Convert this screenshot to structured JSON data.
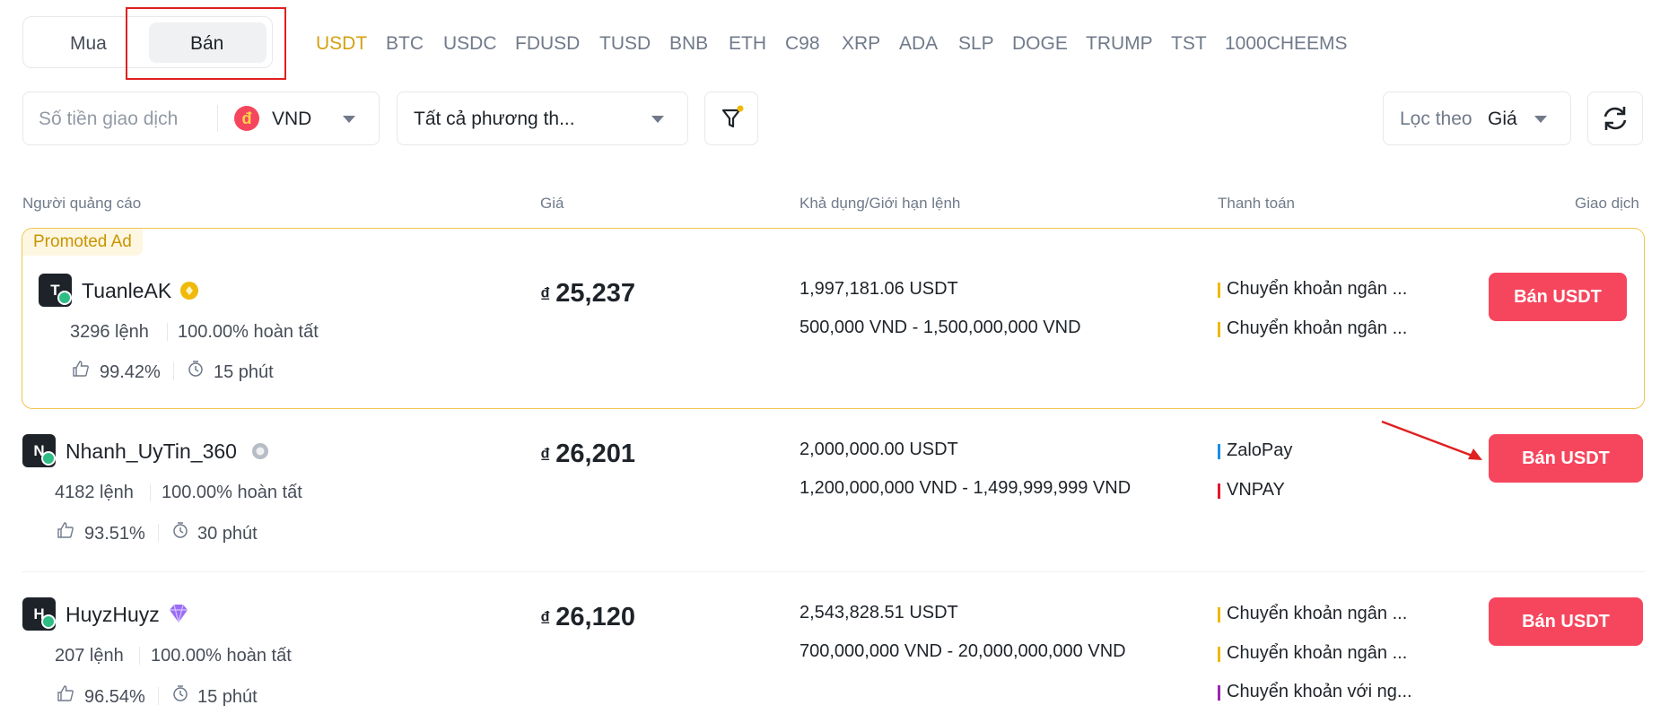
{
  "tabs": {
    "buy": "Mua",
    "sell": "Bán"
  },
  "coins": [
    "USDT",
    "BTC",
    "USDC",
    "FDUSD",
    "TUSD",
    "BNB",
    "ETH",
    "C98",
    "XRP",
    "ADA",
    "SLP",
    "DOGE",
    "TRUMP",
    "TST",
    "1000CHEEMS"
  ],
  "active_coin": "USDT",
  "filters": {
    "amount_placeholder": "Số tiền giao dịch",
    "currency": "VND",
    "currency_icon": "đ",
    "payment_method": "Tất cả phương th...",
    "sort_label": "Lọc theo",
    "sort_value": "Giá"
  },
  "table_headers": {
    "advertiser": "Người quảng cáo",
    "price": "Giá",
    "available": "Khả dụng/Giới hạn lệnh",
    "payment": "Thanh toán",
    "trade": "Giao dịch"
  },
  "promoted_label": "Promoted Ad",
  "rows": [
    {
      "initial": "T",
      "name": "TuanleAK",
      "orders": "3296 lệnh",
      "completion": "100.00% hoàn tất",
      "rating": "99.42%",
      "time": "15 phút",
      "currency_symbol": "₫",
      "price": "25,237",
      "available": "1,997,181.06 USDT",
      "limit": "500,000 VND - 1,500,000,000 VND",
      "payments": [
        "Chuyển khoản ngân ...",
        "Chuyển khoản ngân ..."
      ],
      "button": "Bán USDT"
    },
    {
      "initial": "N",
      "name": "Nhanh_UyTin_360",
      "orders": "4182 lệnh",
      "completion": "100.00% hoàn tất",
      "rating": "93.51%",
      "time": "30 phút",
      "currency_symbol": "₫",
      "price": "26,201",
      "available": "2,000,000.00 USDT",
      "limit": "1,200,000,000 VND - 1,499,999,999 VND",
      "payments": [
        "ZaloPay",
        "VNPAY"
      ],
      "button": "Bán USDT"
    },
    {
      "initial": "H",
      "name": "HuyzHuyz",
      "orders": "207 lệnh",
      "completion": "100.00% hoàn tất",
      "rating": "96.54%",
      "time": "15 phút",
      "currency_symbol": "₫",
      "price": "26,120",
      "available": "2,543,828.51 USDT",
      "limit": "700,000,000 VND - 20,000,000,000 VND",
      "payments": [
        "Chuyển khoản ngân ...",
        "Chuyển khoản ngân ...",
        "Chuyển khoản với ng..."
      ],
      "button": "Bán USDT"
    }
  ],
  "colors": {
    "accent": "#d4a012",
    "sell_button": "#f6465d",
    "promo_border": "#f0c651",
    "highlight_box": "#e02020",
    "payment_bank": "#f0b90b",
    "payment_zalopay": "#1a8fe3",
    "payment_vnpay": "#e0182d",
    "payment_other": "#9c27b0"
  }
}
